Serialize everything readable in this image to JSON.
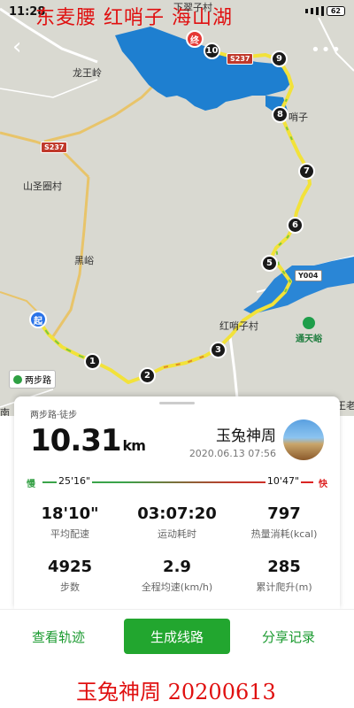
{
  "status_bar": {
    "time": "11:28",
    "battery": "62"
  },
  "overlay_title": "东麦腰 红哨子 海山湖",
  "map": {
    "labels": {
      "xiaxiang": "下翠子村",
      "longwang": "龙王岭",
      "shanshengquan": "山圣圈村",
      "heiyu": "黑峪",
      "hongshaozi": "红哨子村",
      "shaozi": "哨子",
      "nan": "南",
      "wang": "王老"
    },
    "roads": {
      "s237_a": "S237",
      "s237_b": "S237",
      "y004": "Y004"
    },
    "start_label": "起",
    "end_label": "终",
    "km_markers": [
      "1",
      "2",
      "3",
      "5",
      "6",
      "7",
      "8",
      "9",
      "10"
    ],
    "walk_tag": "两步路",
    "poi": "通天峪"
  },
  "card": {
    "sport_type": "两步路·徒步",
    "distance": "10.31",
    "distance_unit": "km",
    "username": "玉兔神周",
    "datetime": "2020.06.13 07:56",
    "pace": {
      "slow_label": "慢",
      "fast_label": "快",
      "min": "25'16\"",
      "max": "10'47\""
    },
    "stats": [
      {
        "value": "18'10\"",
        "label": "平均配速"
      },
      {
        "value": "03:07:20",
        "label": "运动耗时"
      },
      {
        "value": "797",
        "label": "热量消耗(kcal)"
      },
      {
        "value": "4925",
        "label": "步数"
      },
      {
        "value": "2.9",
        "label": "全程均速(km/h)"
      },
      {
        "value": "285",
        "label": "累计爬升(m)"
      }
    ]
  },
  "actions": {
    "view_track": "查看轨迹",
    "generate_route": "生成线路",
    "share_record": "分享记录"
  },
  "footer": "玉兔神周  20200613",
  "colors": {
    "accent_green": "#22a62f",
    "water": "#1e7fd0",
    "track": "#f2e23a"
  }
}
